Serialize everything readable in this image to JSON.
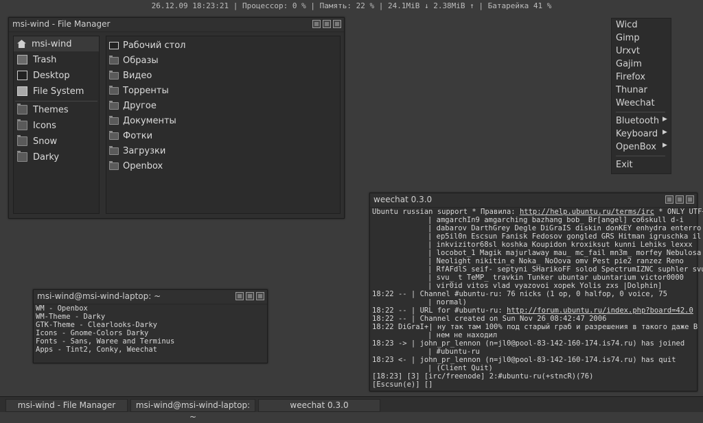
{
  "statusbar": {
    "text": "26.12.09 18:23:21 | Процессор: 0 % | Память: 22 % | 24.1MiB ↓ 2.38MiB ↑ | Батарейка 41 %"
  },
  "file_manager": {
    "title": "msi-wind - File Manager",
    "places": [
      {
        "label": "msi-wind",
        "icon": "home-icon"
      },
      {
        "label": "Trash",
        "icon": "trash-icon"
      },
      {
        "label": "Desktop",
        "icon": "desktop-icon"
      },
      {
        "label": "File System",
        "icon": "drive-icon"
      }
    ],
    "bookmarks": [
      {
        "label": "Themes",
        "icon": "folder-icon"
      },
      {
        "label": "Icons",
        "icon": "folder-icon"
      },
      {
        "label": "Snow",
        "icon": "folder-icon"
      },
      {
        "label": "Darky",
        "icon": "folder-icon"
      }
    ],
    "files": [
      {
        "label": "Рабочий стол",
        "icon": "desktop-icon"
      },
      {
        "label": "Образы",
        "icon": "folder-icon"
      },
      {
        "label": "Видео",
        "icon": "folder-icon"
      },
      {
        "label": "Торренты",
        "icon": "folder-icon"
      },
      {
        "label": "Другое",
        "icon": "folder-icon"
      },
      {
        "label": "Документы",
        "icon": "folder-icon"
      },
      {
        "label": "Фотки",
        "icon": "folder-icon"
      },
      {
        "label": "Загрузки",
        "icon": "folder-icon"
      },
      {
        "label": "Openbox",
        "icon": "folder-icon"
      }
    ]
  },
  "menu": {
    "apps": [
      "Wicd",
      "Gimp",
      "Urxvt",
      "Gajim",
      "Firefox",
      "Thunar",
      "Weechat"
    ],
    "submenus": [
      "Bluetooth",
      "Keyboard",
      "OpenBox"
    ],
    "exit": "Exit"
  },
  "terminal": {
    "title": "msi-wind@msi-wind-laptop: ~",
    "lines": [
      "WM - Openbox",
      "WM-Theme - Darky",
      "GTK-Theme - Clearlooks-Darky",
      "Icons - Gnome-Colors Darky",
      "Fonts - Sans, Waree and Terminus",
      "Apps - Tint2, Conky, Weechat"
    ]
  },
  "weechat": {
    "title": "weechat 0.3.0",
    "topic_prefix": "Ubuntu russian support * Правила: ",
    "topic_url": "http://help.ubuntu.ru/terms/irc",
    "topic_suffix": " * ONLY UTF++",
    "nick_lines": [
      "amgarchIn9 amgarching bazhang bob_ Br[angel] co6skull d-i",
      "dabarov DarthGrey Degle DiGraIS diskin donKEY enhydra enterro",
      "ep5il0n Escsun Fanisk Fedosov gongled GRS Hitman igruschka il",
      "inkvizitor68sl koshka Koupidon kroxiksut kunni Lehiks lexxx",
      "locobot_1 Magik majurlaway mau_ mc_fail mn3m_ morfey Nebulosa",
      "Neolight nikitin_e Noka_ NoOova omv Pest pie2 ranzez Reno",
      "RfAFdlS seif- septyni SHarikoFF solod SpectrumIZNC suphler svu",
      "svu_ t TeMP_ travkin Tunker ubuntar ubuntarium victor0000",
      "vir0id vitos vlad vyazovoi xopek Yolis zxs |Dolphin]"
    ],
    "messages": [
      {
        "time": "18:22",
        "nick": "   --",
        "text": "Channel #ubuntu-ru: 76 nicks (1 op, 0 halfop, 0 voice, 75"
      },
      {
        "time": "",
        "nick": "",
        "text": "normal)"
      },
      {
        "time": "18:22",
        "nick": "   --",
        "text": "URL for #ubuntu-ru: ",
        "url": "http://forum.ubuntu.ru/index.php?board=42.0"
      },
      {
        "time": "18:22",
        "nick": "   --",
        "text": "Channel created on Sun Nov 26 08:42:47 2006"
      },
      {
        "time": "18:22",
        "nick": "DiGraI+",
        "text": "ну так там 100% под старый граб и разрешения в такого даже В"
      },
      {
        "time": "",
        "nick": "",
        "text": "нем не находил"
      },
      {
        "time": "18:23",
        "nick": "   ->",
        "text": "john_pr_lennon (n=jl0@pool-83-142-160-174.is74.ru) has joined"
      },
      {
        "time": "",
        "nick": "",
        "text": "#ubuntu-ru"
      },
      {
        "time": "18:23",
        "nick": "   <-",
        "text": "john_pr_lennon (n=jl0@pool-83-142-160-174.is74.ru) has quit"
      },
      {
        "time": "",
        "nick": "",
        "text": "(Client Quit)"
      }
    ],
    "status_line": "[18:23] [3] [irc/freenode] 2:#ubuntu-ru(+stncR)(76)",
    "input_line": "[Escsun(e)] []"
  },
  "taskbar": {
    "tasks": [
      "msi-wind - File Manager",
      "msi-wind@msi-wind-laptop: ~",
      "weechat 0.3.0"
    ]
  }
}
